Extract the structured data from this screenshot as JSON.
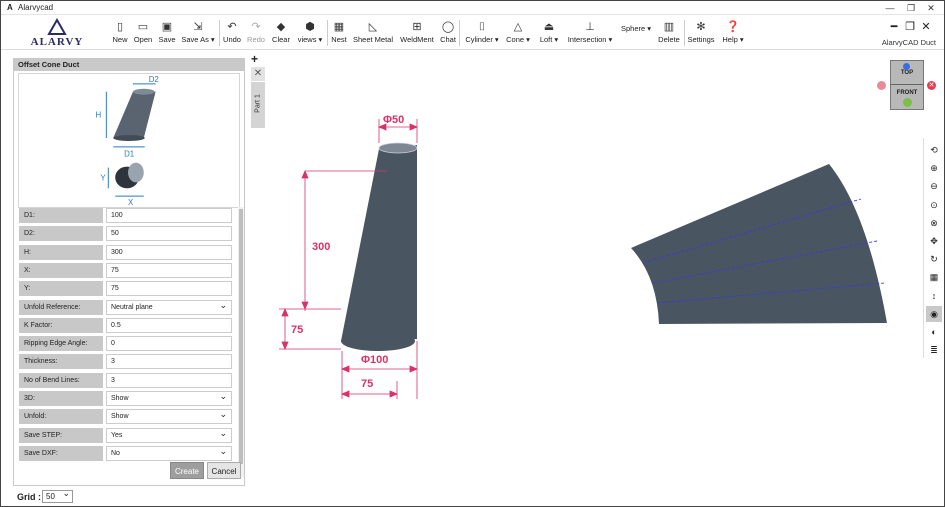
{
  "window": {
    "title": "Alarvycad",
    "app_icon": "A"
  },
  "brand": {
    "logo_text": "ALARVY",
    "app_name": "AlarvyCAD Duct"
  },
  "toolbar": {
    "items": [
      {
        "label": "New",
        "icon": "new-file-icon",
        "glyph": "🗋"
      },
      {
        "label": "Open",
        "icon": "folder-open-icon",
        "glyph": "📂"
      },
      {
        "label": "Save",
        "icon": "save-icon",
        "glyph": "💾"
      },
      {
        "label": "Save As ▾",
        "icon": "save-as-icon",
        "glyph": "🖫"
      },
      {
        "label": "Undo",
        "icon": "undo-icon",
        "glyph": "↶"
      },
      {
        "label": "Redo",
        "icon": "redo-icon",
        "glyph": "↷"
      },
      {
        "label": "Clear",
        "icon": "eraser-icon",
        "glyph": "⌫"
      },
      {
        "label": "views ▾",
        "icon": "cube-icon",
        "glyph": "⬢"
      },
      {
        "label": "Nest",
        "icon": "nest-icon",
        "glyph": "▦"
      },
      {
        "label": "Sheet Metal",
        "icon": "sheet-metal-icon",
        "glyph": "◺"
      },
      {
        "label": "WeldMent",
        "icon": "weldment-icon",
        "glyph": "⚙"
      },
      {
        "label": "Chat",
        "icon": "chat-icon",
        "glyph": "💬"
      },
      {
        "label": "Cylinder ▾",
        "icon": "cylinder-icon",
        "glyph": "⌷"
      },
      {
        "label": "Cone ▾",
        "icon": "cone-icon",
        "glyph": "△"
      },
      {
        "label": "Loft ▾",
        "icon": "loft-icon",
        "glyph": "⏏"
      },
      {
        "label": "Intersection ▾",
        "icon": "intersection-icon",
        "glyph": "⊥"
      },
      {
        "label": "Sphere ▾",
        "icon": "sphere-icon",
        "glyph": ""
      },
      {
        "label": "Delete",
        "icon": "trash-icon",
        "glyph": "🗑"
      },
      {
        "label": "Settings",
        "icon": "gear-icon",
        "glyph": "⚙"
      },
      {
        "label": "Help ▾",
        "icon": "help-icon",
        "glyph": "?"
      }
    ]
  },
  "panel": {
    "title": "Offset Cone Duct",
    "diagram_labels": {
      "d2": "D2",
      "h": "H",
      "d1": "D1",
      "y": "Y",
      "x": "X"
    },
    "fields": [
      {
        "label": "D1:",
        "value": "100",
        "type": "text"
      },
      {
        "label": "D2:",
        "value": "50",
        "type": "text"
      },
      {
        "label": "H:",
        "value": "300",
        "type": "text"
      },
      {
        "label": "X:",
        "value": "75",
        "type": "text"
      },
      {
        "label": "Y:",
        "value": "75",
        "type": "text"
      },
      {
        "label": "Unfold Reference:",
        "value": "Neutral plane",
        "type": "select"
      },
      {
        "label": "K Factor:",
        "value": "0.5",
        "type": "text"
      },
      {
        "label": "Ripping Edge Angle:",
        "value": "0",
        "type": "text"
      },
      {
        "label": "Thickness:",
        "value": "3",
        "type": "text"
      },
      {
        "label": "No of Bend Lines:",
        "value": "3",
        "type": "text"
      },
      {
        "label": "3D:",
        "value": "Show",
        "type": "select"
      },
      {
        "label": "Unfold:",
        "value": "Show",
        "type": "select"
      },
      {
        "label": "Save STEP:",
        "value": "Yes",
        "type": "select"
      },
      {
        "label": "Save DXF:",
        "value": "No",
        "type": "select"
      }
    ],
    "create_label": "Create",
    "cancel_label": "Cancel"
  },
  "tabs": {
    "add": "+",
    "close": "✕",
    "part_label": "Part 1"
  },
  "viewcube": {
    "top": "TOP",
    "front": "FRONT"
  },
  "dimensions": {
    "top_dia": "Φ50",
    "height": "300",
    "offset_y": "75",
    "bottom_dia": "Φ100",
    "offset_x": "75"
  },
  "right_tools": [
    {
      "icon": "orbit-icon",
      "glyph": "⟲"
    },
    {
      "icon": "zoom-in-icon",
      "glyph": "⊕"
    },
    {
      "icon": "zoom-out-icon",
      "glyph": "⊖"
    },
    {
      "icon": "zoom-fit-icon",
      "glyph": "⊙"
    },
    {
      "icon": "zoom-window-icon",
      "glyph": "⊗"
    },
    {
      "icon": "pan-icon",
      "glyph": "✥"
    },
    {
      "icon": "rotate-icon",
      "glyph": "↻"
    },
    {
      "icon": "grid-icon",
      "glyph": "▦"
    },
    {
      "icon": "measure-icon",
      "glyph": "↕"
    },
    {
      "icon": "eye-icon",
      "glyph": "◉"
    },
    {
      "icon": "contrast-icon",
      "glyph": "◐"
    },
    {
      "icon": "layers-icon",
      "glyph": "≣"
    }
  ],
  "grid": {
    "label": "Grid :",
    "value": "50"
  },
  "colors": {
    "dimension": "#d6336c",
    "shape": "#4a5562",
    "bend_line": "#3a3adf"
  }
}
